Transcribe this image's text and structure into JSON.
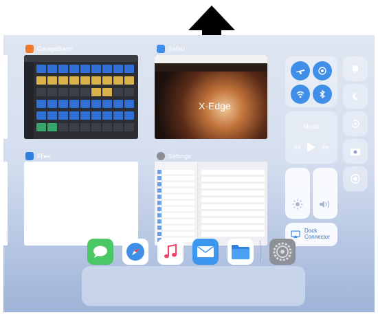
{
  "app_switcher": {
    "cards": [
      {
        "name": "GarageBand"
      },
      {
        "name": "Safari"
      },
      {
        "name": "Files"
      },
      {
        "name": "Settings"
      }
    ],
    "safari_page": {
      "headline": "X-Edge"
    }
  },
  "control_center": {
    "music": {
      "label": "Music"
    },
    "screen_mirroring": {
      "label": "Dock Connector"
    }
  },
  "colors": {
    "accent_blue": "#3f8ee8",
    "garageband_pad_blue": "#2f6fd6",
    "garageband_pad_yellow": "#d9b24c",
    "garageband_pad_green": "#36a66a"
  },
  "icons": [
    "up-arrow-icon",
    "airplane-icon",
    "airdrop-icon",
    "wifi-icon",
    "bluetooth-icon",
    "bell-icon",
    "moon-icon",
    "rotation-lock-icon",
    "camera-icon",
    "play-icon",
    "rewind-icon",
    "fast-forward-icon",
    "brightness-icon",
    "volume-icon",
    "screen-mirroring-icon",
    "messages-icon",
    "safari-icon",
    "music-icon",
    "mail-icon",
    "files-icon",
    "settings-icon"
  ]
}
